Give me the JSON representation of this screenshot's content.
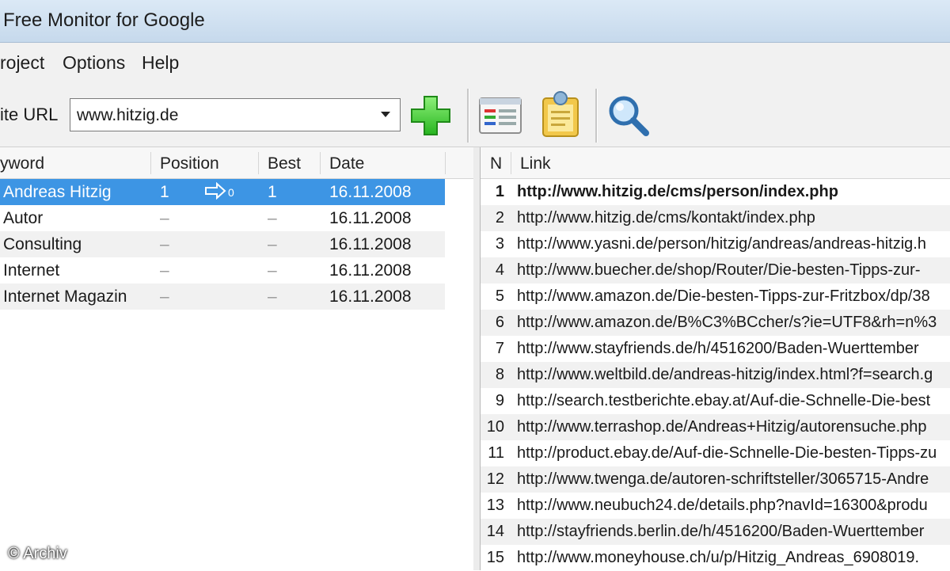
{
  "window": {
    "title": "Free Monitor for Google"
  },
  "menu": [
    "roject",
    "Options",
    "Help"
  ],
  "toolbar": {
    "url_label": "ite URL",
    "url_value": "www.hitzig.de",
    "icons": [
      "add-icon",
      "report-icon",
      "clipboard-icon",
      "search-icon"
    ]
  },
  "keywords": {
    "headers": {
      "keyword": "yword",
      "position": "Position",
      "best": "Best",
      "date": "Date"
    },
    "rows": [
      {
        "keyword": "Andreas Hitzig",
        "position": "1",
        "change": "0",
        "best": "1",
        "date": "16.11.2008"
      },
      {
        "keyword": "Autor",
        "position": "–",
        "best": "–",
        "date": "16.11.2008"
      },
      {
        "keyword": "Consulting",
        "position": "–",
        "best": "–",
        "date": "16.11.2008"
      },
      {
        "keyword": "Internet",
        "position": "–",
        "best": "–",
        "date": "16.11.2008"
      },
      {
        "keyword": "Internet Magazin",
        "position": "–",
        "best": "–",
        "date": "16.11.2008"
      }
    ]
  },
  "links": {
    "headers": {
      "n": "N",
      "link": "Link"
    },
    "rows": [
      {
        "n": "1",
        "url": "http://www.hitzig.de/cms/person/index.php"
      },
      {
        "n": "2",
        "url": "http://www.hitzig.de/cms/kontakt/index.php"
      },
      {
        "n": "3",
        "url": "http://www.yasni.de/person/hitzig/andreas/andreas-hitzig.h"
      },
      {
        "n": "4",
        "url": "http://www.buecher.de/shop/Router/Die-besten-Tipps-zur-"
      },
      {
        "n": "5",
        "url": "http://www.amazon.de/Die-besten-Tipps-zur-Fritzbox/dp/38"
      },
      {
        "n": "6",
        "url": "http://www.amazon.de/B%C3%BCcher/s?ie=UTF8&rh=n%3"
      },
      {
        "n": "7",
        "url": "http://www.stayfriends.de/h/4516200/Baden-Wuerttember"
      },
      {
        "n": "8",
        "url": "http://www.weltbild.de/andreas-hitzig/index.html?f=search.g"
      },
      {
        "n": "9",
        "url": "http://search.testberichte.ebay.at/Auf-die-Schnelle-Die-best"
      },
      {
        "n": "10",
        "url": "http://www.terrashop.de/Andreas+Hitzig/autorensuche.php"
      },
      {
        "n": "11",
        "url": "http://product.ebay.de/Auf-die-Schnelle-Die-besten-Tipps-zu"
      },
      {
        "n": "12",
        "url": "http://www.twenga.de/autoren-schriftsteller/3065715-Andre"
      },
      {
        "n": "13",
        "url": "http://www.neubuch24.de/details.php?navId=16300&produ"
      },
      {
        "n": "14",
        "url": "http://stayfriends.berlin.de/h/4516200/Baden-Wuerttember"
      },
      {
        "n": "15",
        "url": "http://www.moneyhouse.ch/u/p/Hitzig_Andreas_6908019."
      }
    ]
  },
  "watermark": "© Archiv"
}
